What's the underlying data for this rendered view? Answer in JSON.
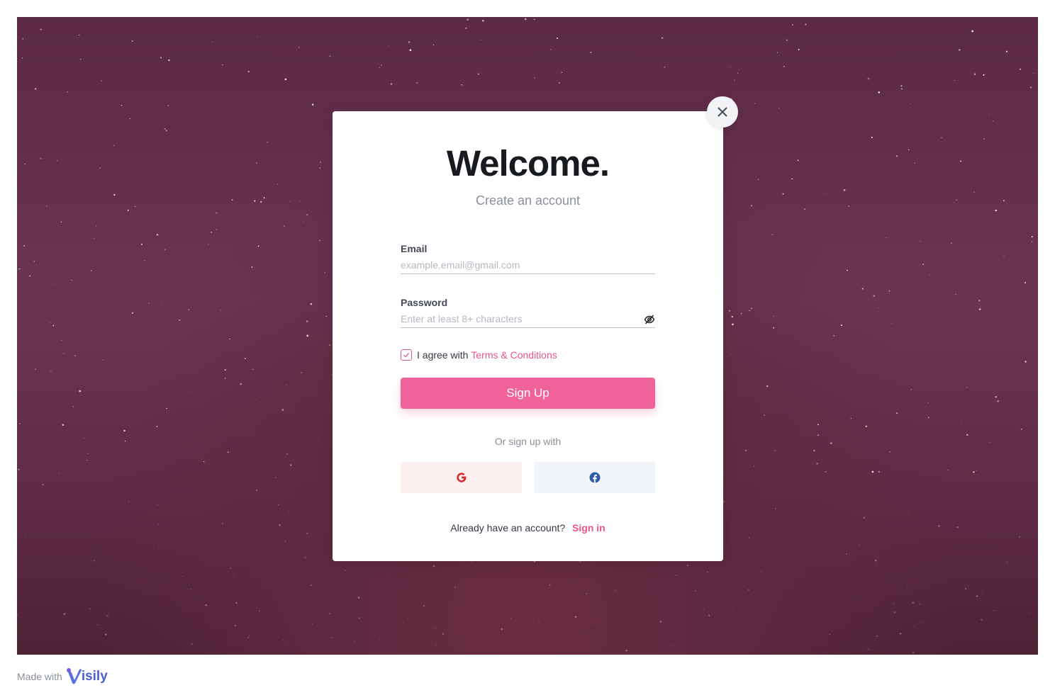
{
  "modal": {
    "title": "Welcome.",
    "subtitle": "Create an account",
    "email": {
      "label": "Email",
      "placeholder": "example.email@gmail.com",
      "value": ""
    },
    "password": {
      "label": "Password",
      "placeholder": "Enter at least 8+ characters",
      "value": ""
    },
    "agree": {
      "text": "I agree with",
      "link": "Terms & Conditions",
      "checked": true
    },
    "signup_label": "Sign Up",
    "or_text": "Or sign up with",
    "social": [
      {
        "name": "google",
        "icon": "google-icon",
        "color": "#d32f2f"
      },
      {
        "name": "facebook",
        "icon": "facebook-icon",
        "color": "#2f5ba7"
      }
    ],
    "footer_text": "Already have an account?",
    "signin_label": "Sign in"
  },
  "branding": {
    "made_with": "Made with",
    "logo_text": "isily"
  },
  "colors": {
    "accent": "#f0639a",
    "link": "#e8548a",
    "background": "#5e2c45"
  }
}
